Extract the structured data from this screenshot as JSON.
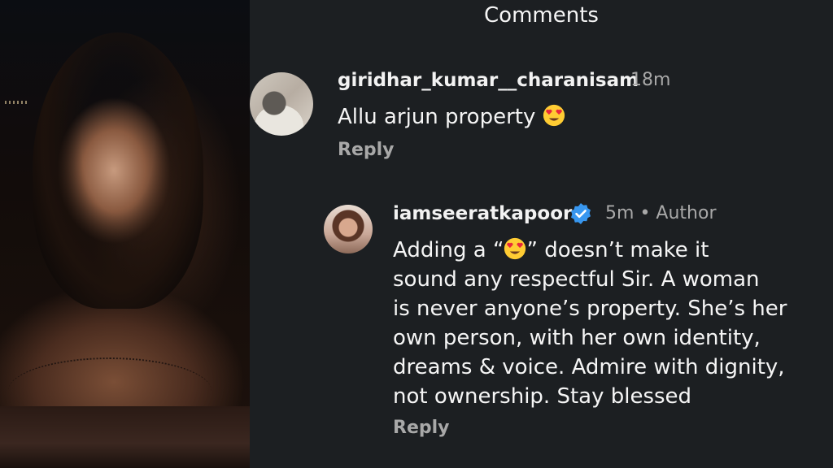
{
  "header": {
    "title": "Comments"
  },
  "comments": [
    {
      "username": "giridhar_kumar__charanisam",
      "time": "18m",
      "text": "Allu arjun property",
      "emoji": "heart-eyes",
      "reply_label": "Reply"
    }
  ],
  "reply": {
    "username": "iamseeratkapoor",
    "verified": true,
    "time": "5m",
    "separator": "•",
    "role": "Author",
    "text_before_emoji": "Adding a “",
    "emoji": "heart-eyes",
    "lines": [
      "” doesn’t make it",
      "sound any respectful Sir. A woman",
      "is never anyone’s property. She’s her",
      "own person, with her own identity,",
      "dreams & voice. Admire with dignity,",
      "not ownership. Stay blessed"
    ],
    "reply_label": "Reply"
  },
  "colors": {
    "background": "#1c1f22",
    "secondary_text": "#a8a8a8",
    "verified_badge": "#3897f0"
  }
}
